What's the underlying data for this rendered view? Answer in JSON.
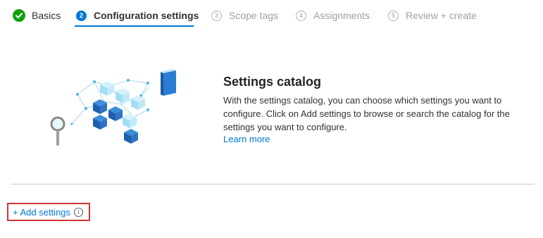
{
  "wizard": {
    "steps": [
      {
        "number": "",
        "label": "Basics",
        "state": "done"
      },
      {
        "number": "2",
        "label": "Configuration settings",
        "state": "active"
      },
      {
        "number": "3",
        "label": "Scope tags",
        "state": "pending"
      },
      {
        "number": "4",
        "label": "Assignments",
        "state": "pending"
      },
      {
        "number": "5",
        "label": "Review + create",
        "state": "pending"
      }
    ]
  },
  "catalog": {
    "title": "Settings catalog",
    "description": "With the settings catalog, you can choose which settings you want to configure. Click on Add settings to browse or search the catalog for the settings you want to configure.",
    "learn_more": "Learn more"
  },
  "actions": {
    "add_settings": "+ Add settings",
    "info_glyph": "i"
  },
  "colors": {
    "accent": "#0078d4",
    "done_green": "#13a10e",
    "highlight_red": "#d13438"
  },
  "icons": {
    "done": "checkmark-circle-icon",
    "info": "info-icon",
    "illustration": "settings-catalog-illustration"
  }
}
